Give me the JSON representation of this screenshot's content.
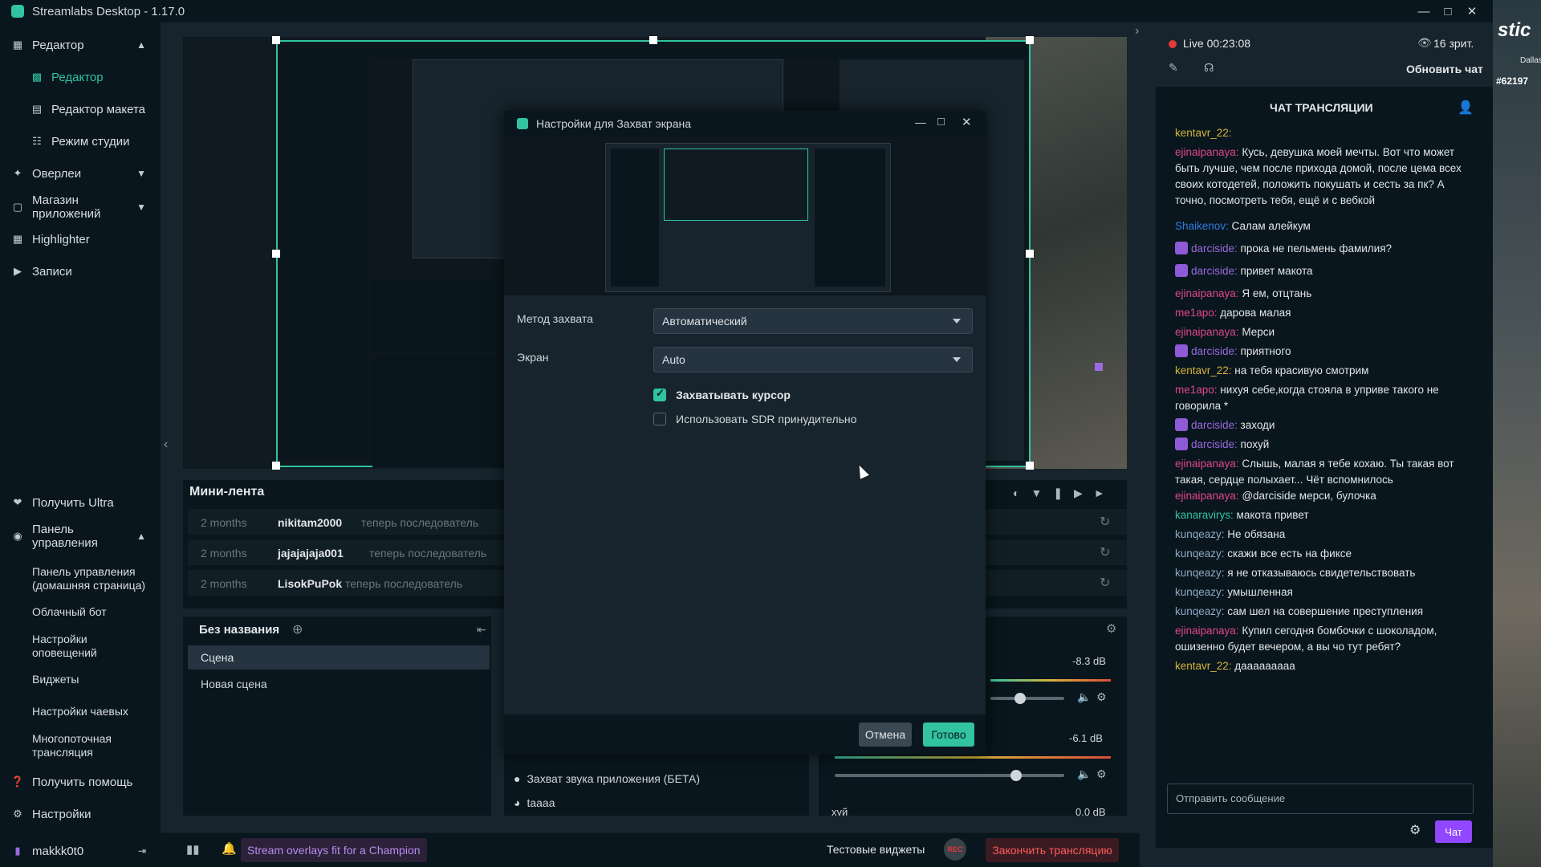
{
  "window": {
    "title": "Streamlabs Desktop - 1.17.0"
  },
  "sidebar": {
    "editor_group": "Редактор",
    "editor": "Редактор",
    "layout_editor": "Редактор макета",
    "studio_mode": "Режим студии",
    "overlays": "Оверлеи",
    "app_store": "Магазин приложений",
    "highlighter": "Highlighter",
    "recordings": "Записи",
    "get_ultra": "Получить Ultra",
    "dashboard": "Панель управления",
    "dashboard_home": "Панель управления (домашняя страница)",
    "cloudbot": "Облачный бот",
    "alert_settings": "Настройки оповещений",
    "widgets": "Виджеты",
    "tip_settings": "Настройки чаевых",
    "multistream": "Многопоточная трансляция",
    "get_help": "Получить помощь",
    "settings": "Настройки",
    "username": "makkk0t0"
  },
  "minifeed": {
    "title": "Мини-лента",
    "items": [
      {
        "time": "2 months",
        "user": "nikitam2000",
        "action": "теперь последователь"
      },
      {
        "time": "2 months",
        "user": "jajajajaja001",
        "action": "теперь последователь"
      },
      {
        "time": "2 months",
        "user": "LisokPuPok",
        "action": "теперь последователь"
      }
    ]
  },
  "scenes": {
    "collection": "Без названия",
    "items": [
      "Сцена",
      "Новая сцена"
    ]
  },
  "sources": {
    "items": [
      "Захват звука приложения (БЕТА)",
      "taaaa"
    ]
  },
  "mixer": {
    "db1": "-8.3 dB",
    "db2": "-6.1 dB",
    "db3": "0.0 dB",
    "track3": "хуй",
    "level1": 0.4,
    "level2": 0.79
  },
  "dialog": {
    "title": "Настройки для Захват экрана",
    "capture_method_label": "Метод захвата",
    "capture_method_value": "Автоматический",
    "screen_label": "Экран",
    "screen_value": "Auto",
    "capture_cursor": "Захватывать курсор",
    "capture_cursor_checked": true,
    "force_sdr": "Использовать SDR принудительно",
    "force_sdr_checked": false,
    "cancel": "Отмена",
    "done": "Готово"
  },
  "bottom": {
    "promo": "Stream overlays fit for a Champion",
    "test_widgets": "Тестовые виджеты",
    "rec": "REC",
    "end_stream": "Закончить трансляцию"
  },
  "live": {
    "status": "Live 00:23:08",
    "viewers": "16 зрит.",
    "refresh_chat": "Обновить чат"
  },
  "chat": {
    "title": "ЧАТ ТРАНСЛЯЦИИ",
    "input_placeholder": "Отправить сообщение",
    "send": "Чат",
    "messages": [
      {
        "user": "kentavr_22:",
        "text": ""
      },
      {
        "user": "ejinaipanaya:",
        "text": " Кусь, девушка моей мечты. Вот что может быть лучше, чем после прихода домой, после цема всех своих котодетей, положить покушать и сесть за пк? А точно, посмотреть тебя, ещё и с вебкой"
      },
      {
        "user": "Shaikenov:",
        "text": " Салам алейкум"
      },
      {
        "user": "darciside:",
        "text": " прока не пельмень фамилия?"
      },
      {
        "user": "darciside:",
        "text": " привет макота"
      },
      {
        "user": "ejinaipanaya:",
        "text": " Я ем, отцтань"
      },
      {
        "user": "me1apo:",
        "text": " дарова малая"
      },
      {
        "user": "ejinaipanaya:",
        "text": " Мерси"
      },
      {
        "user": "darciside:",
        "text": " приятного"
      },
      {
        "user": "kentavr_22:",
        "text": " на тебя красивую смотрим"
      },
      {
        "user": "me1apo:",
        "text": " нихуя себе,когда стояла в уприве такого не говорила *"
      },
      {
        "user": "darciside:",
        "text": " заходи"
      },
      {
        "user": "darciside:",
        "text": " похуй"
      },
      {
        "user": "ejinaipanaya:",
        "text": " Слышь, малая я тебе кохаю. Ты такая вот такая, сердце полыхает... Чёт вспомнилось"
      },
      {
        "user": "ejinaipanaya:",
        "text": " @darciside мерси, булочка"
      },
      {
        "user": "kanaravirys:",
        "text": " макота привет"
      },
      {
        "user": "kunqeazy:",
        "text": " Не обязана"
      },
      {
        "user": "kunqeazy:",
        "text": " скажи все есть на фиксе"
      },
      {
        "user": "kunqeazy:",
        "text": " я не отказываюсь свидетельствовать"
      },
      {
        "user": "kunqeazy:",
        "text": " умышленная"
      },
      {
        "user": "kunqeazy:",
        "text": " сам шел на совершение преступления"
      },
      {
        "user": "ejinaipanaya:",
        "text": " Купил сегодня бомбочки с шоколадом, ошизенно будет вечером, а вы чо тут ребят?"
      },
      {
        "user": "kentavr_22:",
        "text": " дааааааааа"
      }
    ]
  },
  "overlay": {
    "brand": "stic",
    "city": "Dallas",
    "tag": "#62197"
  },
  "colors": {
    "accent": "#31c3a2",
    "bg": "#17242d",
    "panel": "#09161d",
    "live": "#e33b3b"
  }
}
